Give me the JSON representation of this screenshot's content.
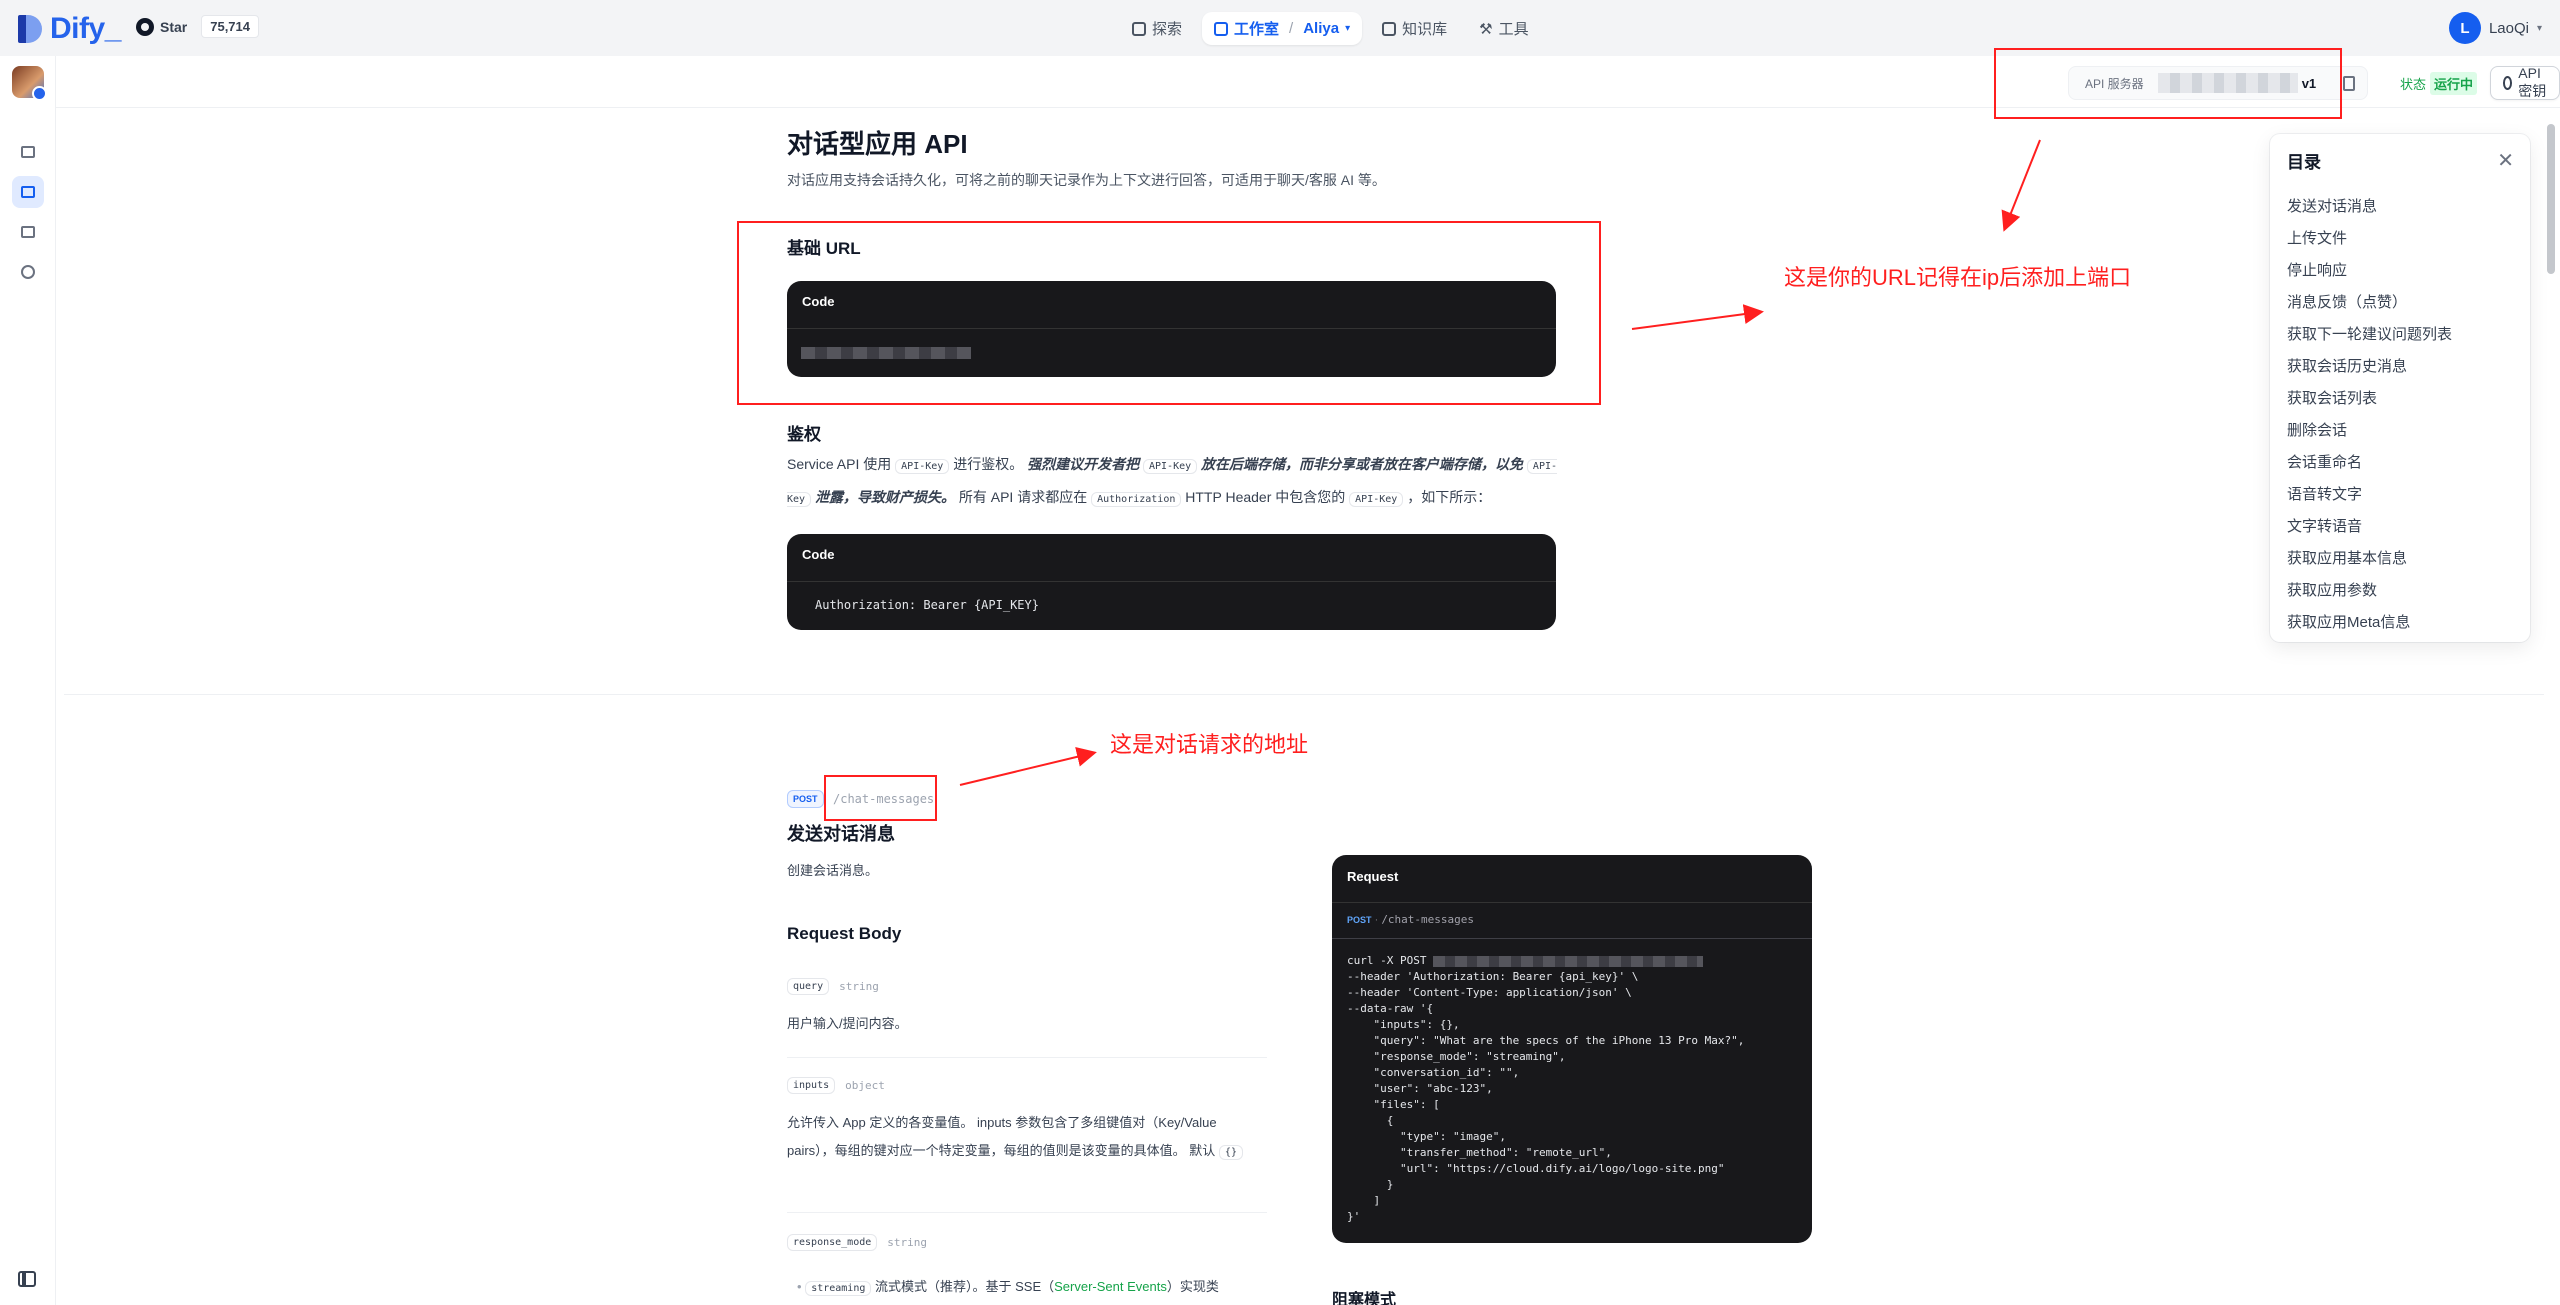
{
  "topbar": {
    "logo": "Dify",
    "star_label": "Star",
    "star_count": "75,714",
    "nav": {
      "explore": "探索",
      "studio": "工作室",
      "workspace": "Aliya",
      "knowledge": "知识库",
      "tools": "工具"
    },
    "user": {
      "initial": "L",
      "name": "LaoQi"
    }
  },
  "subheader": {
    "api_server_label": "API 服务器",
    "api_server_suffix": "v1",
    "status_key": "状态",
    "status_value": "运行中",
    "api_key_button": "API 密钥"
  },
  "doc": {
    "title": "对话型应用 API",
    "description": "对话应用支持会话持久化，可将之前的聊天记录作为上下文进行回答，可适用于聊天/客服 AI 等。",
    "base_url_heading": "基础 URL",
    "code_label": "Code",
    "auth_heading": "鉴权",
    "auth_p1": "Service API 使用",
    "auth_code1": "API-Key",
    "auth_p2": "进行鉴权。",
    "auth_strong1": "强烈建议开发者把",
    "auth_code2": "API-Key",
    "auth_strong2": "放在后端存储，而非分享或者放在客户端存储，以免",
    "auth_code3": "API-Key",
    "auth_strong3": "泄露，导致财产损失。",
    "auth_p3": "所有 API 请求都应在",
    "auth_code4": "Authorization",
    "auth_p4": "HTTP Header 中包含您的",
    "auth_code5": "API-Key",
    "auth_p5": "，如下所示：",
    "auth_code_line": "Authorization: Bearer {API_KEY}"
  },
  "endpoint": {
    "method": "POST",
    "path": "/chat-messages",
    "title": "发送对话消息",
    "description": "创建会话消息。",
    "request_body": "Request Body",
    "params": [
      {
        "name": "query",
        "type": "string",
        "desc": "用户输入/提问内容。"
      },
      {
        "name": "inputs",
        "type": "object",
        "desc": "允许传入 App 定义的各变量值。 inputs 参数包含了多组键值对（Key/Value pairs），每组的键对应一个特定变量，每组的值则是该变量的具体值。 默认",
        "default": "{}"
      },
      {
        "name": "response_mode",
        "type": "string"
      }
    ],
    "streaming_tag": "streaming",
    "streaming_desc": "流式模式（推荐）。基于 SSE（",
    "streaming_link": "Server-Sent Events",
    "streaming_tail": "）实现类",
    "blocking_heading": "阻塞模式"
  },
  "request_panel": {
    "title": "Request",
    "method": "POST",
    "path": "/chat-messages",
    "line1_prefix": "curl -X POST",
    "lines": [
      "--header 'Authorization: Bearer {api_key}' \\",
      "--header 'Content-Type: application/json' \\",
      "--data-raw '{",
      "    \"inputs\": {},",
      "    \"query\": \"What are the specs of the iPhone 13 Pro Max?\",",
      "    \"response_mode\": \"streaming\",",
      "    \"conversation_id\": \"\",",
      "    \"user\": \"abc-123\",",
      "    \"files\": [",
      "      {",
      "        \"type\": \"image\",",
      "        \"transfer_method\": \"remote_url\",",
      "        \"url\": \"https://cloud.dify.ai/logo/logo-site.png\"",
      "      }",
      "    ]",
      "}'"
    ]
  },
  "toc": {
    "title": "目录",
    "items": [
      "发送对话消息",
      "上传文件",
      "停止响应",
      "消息反馈（点赞）",
      "获取下一轮建议问题列表",
      "获取会话历史消息",
      "获取会话列表",
      "删除会话",
      "会话重命名",
      "语音转文字",
      "文字转语音",
      "获取应用基本信息",
      "获取应用参数",
      "获取应用Meta信息"
    ]
  },
  "annotations": {
    "url_note": "这是你的URL记得在ip后添加上端口",
    "path_note": "这是对话请求的地址"
  },
  "colors": {
    "accent": "#155eef",
    "annotation": "#ff1f1f",
    "status_green": "#16a34a",
    "code_bg": "#18181b"
  }
}
